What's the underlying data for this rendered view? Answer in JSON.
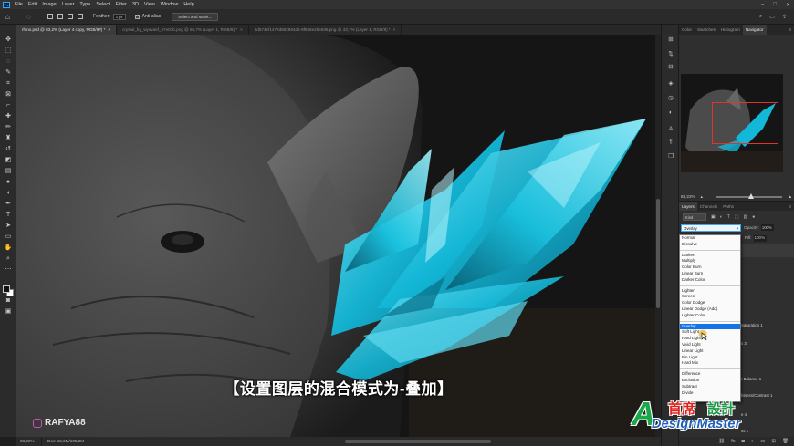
{
  "app": {
    "logo_text": "Ps",
    "menus": [
      "File",
      "Edit",
      "Image",
      "Layer",
      "Type",
      "Select",
      "Filter",
      "3D",
      "View",
      "Window",
      "Help"
    ],
    "window_controls": [
      "–",
      "□",
      "✕"
    ]
  },
  "options_bar": {
    "feather_label": "Feather:",
    "feather_value": "1 px",
    "antialias_label": "Anti-alias",
    "select_mask_label": "Select and Mask..."
  },
  "doc_tabs": [
    {
      "title": "rhino.psd @ 83,2% (Layer 4 copy, RGB/8#) *",
      "active": true
    },
    {
      "title": "crystal_by_wysvaef_67e07b.png @ 66,7% (Layer 1, RGB/8) *",
      "active": false
    },
    {
      "title": "8d574ef1478d882894d6-9f848e25e936.png @ 43,7% (Layer 1, RGB/8) *",
      "active": false
    }
  ],
  "canvas": {
    "subtitle": "【设置图层的混合模式为-叠加】",
    "watermark": "RAFYA88",
    "colors": {
      "crystal": "#13b8d8",
      "crystal_light": "#7fe6f5",
      "crystal_dark": "#0a6f8c"
    }
  },
  "status": {
    "zoom": "83,22%",
    "doc": "Doc: 18,6M/105,2M"
  },
  "panels": {
    "top_tabs": [
      "Color",
      "Swatches",
      "Histogram",
      "Navigator"
    ],
    "active_top_tab": "Navigator",
    "nav_zoom": "83,22%",
    "layer_tabs": [
      "Layers",
      "Channels",
      "Paths"
    ],
    "kind_label": "Kind",
    "blend_mode": "Overlay",
    "opacity_label": "Opacity:",
    "opacity_value": "100%",
    "fill_label": "Fill:",
    "fill_value": "100%",
    "layer_rows": [
      "Saturation 1",
      "s 3",
      "r Balance 1",
      "htness/Contrast 1",
      "e 4",
      "ss 1"
    ]
  },
  "blend_modes": {
    "groups": [
      [
        "Normal",
        "Dissolve"
      ],
      [
        "Darken",
        "Multiply",
        "Color Burn",
        "Linear Burn",
        "Darker Color"
      ],
      [
        "Lighten",
        "Screen",
        "Color Dodge",
        "Linear Dodge (Add)",
        "Lighter Color"
      ],
      [
        "Overlay",
        "Soft Light",
        "Hard Light",
        "Vivid Light",
        "Linear Light",
        "Pin Light",
        "Hard Mix"
      ],
      [
        "Difference",
        "Exclusion",
        "Subtract",
        "Divide"
      ]
    ],
    "selected": "Overlay"
  },
  "logo": {
    "letter": "A",
    "cn_red": "首席",
    "cn_green": "設計",
    "en": "DesignMaster"
  }
}
